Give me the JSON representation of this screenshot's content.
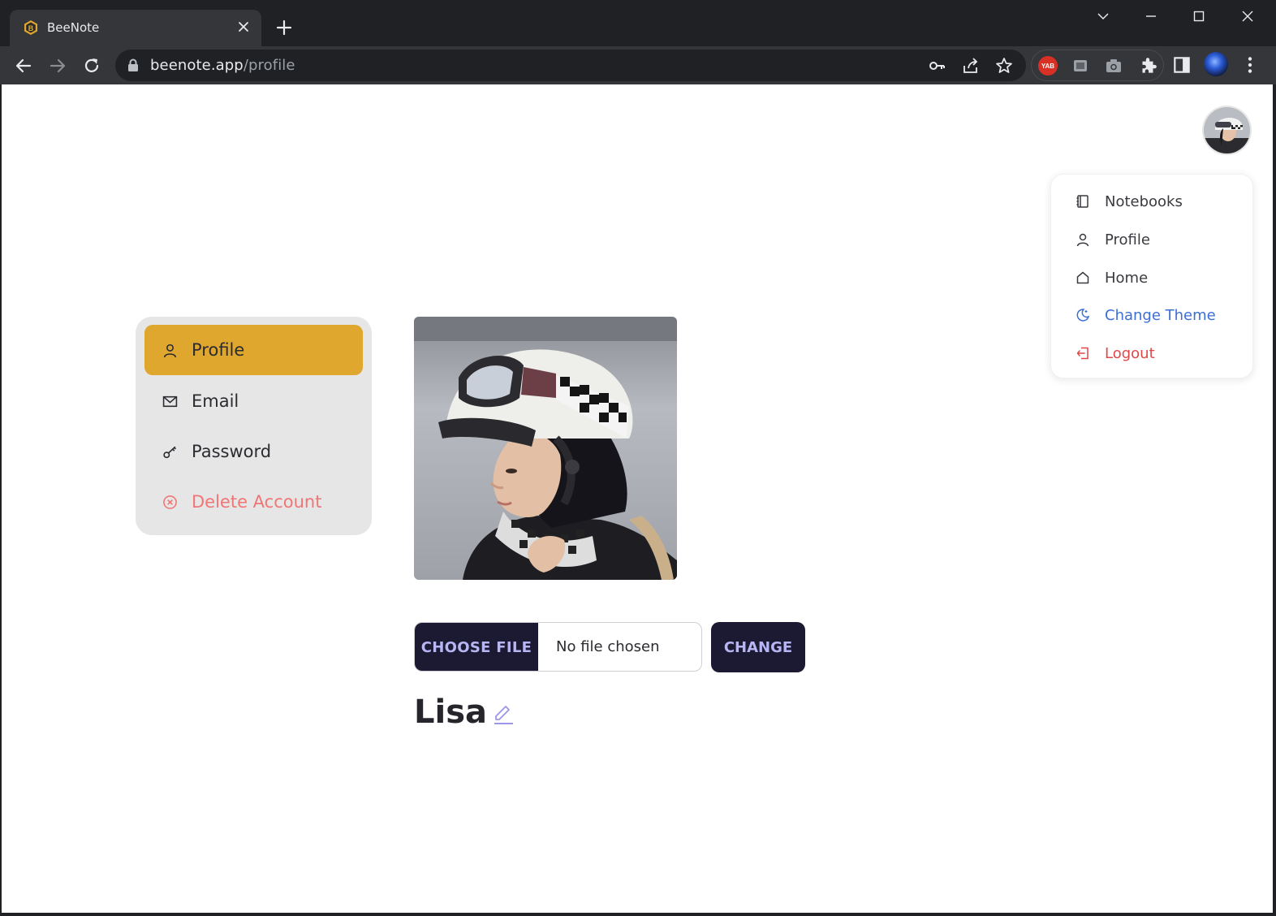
{
  "browser": {
    "tab_title": "BeeNote",
    "url_domain": "beenote.app",
    "url_path": "/profile",
    "extension_badge": "YAB"
  },
  "menu": {
    "items": [
      {
        "label": "Notebooks",
        "icon": "notebook-icon"
      },
      {
        "label": "Profile",
        "icon": "user-icon"
      },
      {
        "label": "Home",
        "icon": "home-icon"
      },
      {
        "label": "Change Theme",
        "icon": "theme-icon"
      },
      {
        "label": "Logout",
        "icon": "logout-icon"
      }
    ]
  },
  "sidebar": {
    "items": [
      {
        "label": "Profile",
        "icon": "user-icon",
        "active": true
      },
      {
        "label": "Email",
        "icon": "mail-icon"
      },
      {
        "label": "Password",
        "icon": "key-icon"
      },
      {
        "label": "Delete Account",
        "icon": "x-circle-icon"
      }
    ]
  },
  "profile": {
    "choose_file_label": "CHOOSE FILE",
    "file_status": "No file chosen",
    "change_label": "CHANGE",
    "name": "Lisa"
  },
  "colors": {
    "accent": "#e0a72e",
    "button_bg": "#1c1a33",
    "button_text": "#b8b5f5",
    "danger": "#e04848",
    "theme_link": "#3b6fd6"
  }
}
